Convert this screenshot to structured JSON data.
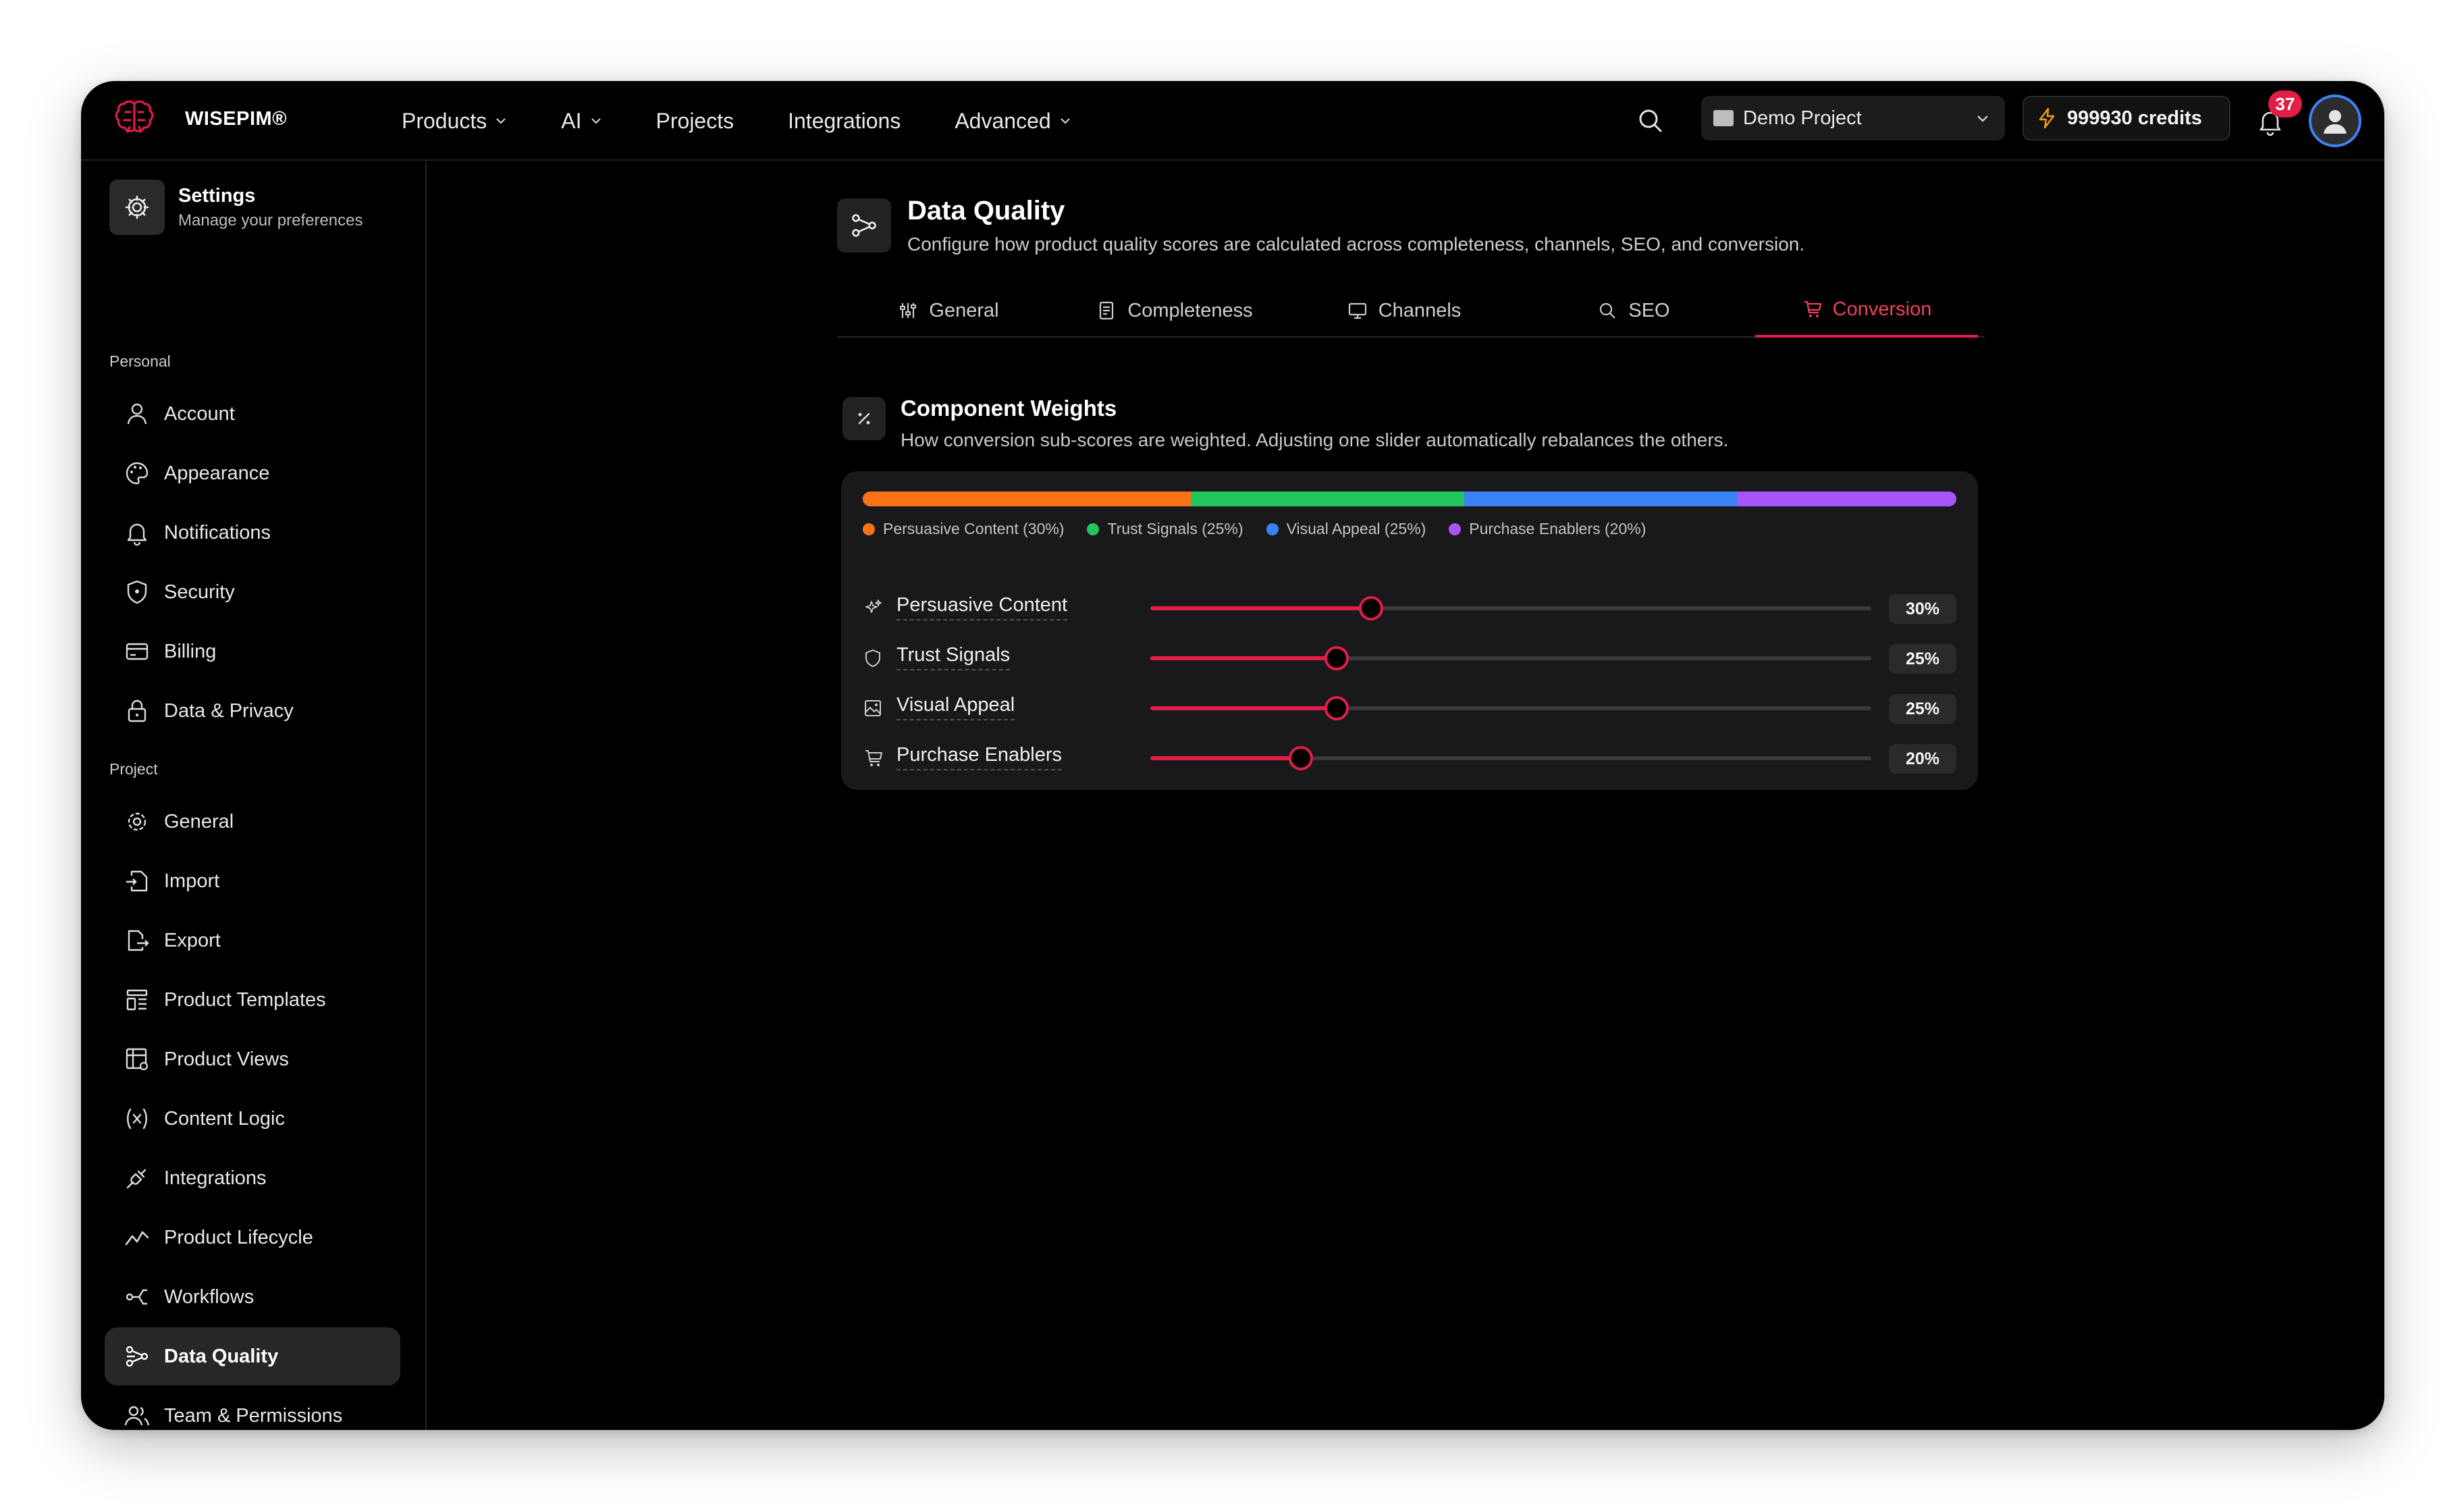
{
  "brand": {
    "name": "WISEPIM®"
  },
  "nav": [
    {
      "label": "Products",
      "dropdown": true
    },
    {
      "label": "AI",
      "dropdown": true
    },
    {
      "label": "Projects",
      "dropdown": false
    },
    {
      "label": "Integrations",
      "dropdown": false
    },
    {
      "label": "Advanced",
      "dropdown": true
    }
  ],
  "header": {
    "project": "Demo Project",
    "credits": "999930 credits",
    "notifications": "37"
  },
  "sidebar": {
    "title": "Settings",
    "subtitle": "Manage your preferences",
    "personal_label": "Personal",
    "project_label": "Project",
    "personal": [
      {
        "label": "Account",
        "icon": "user-icon"
      },
      {
        "label": "Appearance",
        "icon": "palette-icon"
      },
      {
        "label": "Notifications",
        "icon": "bell-icon"
      },
      {
        "label": "Security",
        "icon": "shield-icon"
      },
      {
        "label": "Billing",
        "icon": "credit-card-icon"
      },
      {
        "label": "Data & Privacy",
        "icon": "lock-icon"
      }
    ],
    "project": [
      {
        "label": "General",
        "icon": "gear-icon"
      },
      {
        "label": "Import",
        "icon": "file-import-icon"
      },
      {
        "label": "Export",
        "icon": "file-export-icon"
      },
      {
        "label": "Product Templates",
        "icon": "template-icon"
      },
      {
        "label": "Product Views",
        "icon": "table-settings-icon"
      },
      {
        "label": "Content Logic",
        "icon": "variable-icon"
      },
      {
        "label": "Integrations",
        "icon": "plug-icon"
      },
      {
        "label": "Product Lifecycle",
        "icon": "trend-icon"
      },
      {
        "label": "Workflows",
        "icon": "workflow-icon"
      },
      {
        "label": "Data Quality",
        "icon": "data-quality-icon",
        "active": true
      },
      {
        "label": "Team & Permissions",
        "icon": "users-icon"
      }
    ]
  },
  "page": {
    "title": "Data Quality",
    "subtitle": "Configure how product quality scores are calculated across completeness, channels, SEO, and conversion.",
    "tabs": [
      {
        "label": "General",
        "icon": "sliders-icon"
      },
      {
        "label": "Completeness",
        "icon": "checklist-icon"
      },
      {
        "label": "Channels",
        "icon": "monitor-icon"
      },
      {
        "label": "SEO",
        "icon": "search-icon"
      },
      {
        "label": "Conversion",
        "icon": "cart-icon",
        "active": true
      }
    ]
  },
  "weights": {
    "title": "Component Weights",
    "subtitle": "How conversion sub-scores are weighted. Adjusting one slider automatically rebalances the others.",
    "components": [
      {
        "label": "Persuasive Content",
        "legend": "Persuasive Content (30%)",
        "value": 30,
        "display": "30%",
        "color": "#f97316",
        "icon": "sparkles-icon"
      },
      {
        "label": "Trust Signals",
        "legend": "Trust Signals (25%)",
        "value": 25,
        "display": "25%",
        "color": "#22c55e",
        "icon": "shield-icon"
      },
      {
        "label": "Visual Appeal",
        "legend": "Visual Appeal (25%)",
        "value": 25,
        "display": "25%",
        "color": "#3b82f6",
        "icon": "image-icon"
      },
      {
        "label": "Purchase Enablers",
        "legend": "Purchase Enablers (20%)",
        "value": 20,
        "display": "20%",
        "color": "#a855f7",
        "icon": "cart-icon"
      }
    ],
    "slider_fill": [
      0.306,
      0.258,
      0.258,
      0.209
    ]
  },
  "colors": {
    "accent": "#e11d48",
    "background": "#000000",
    "panel": "#19191b"
  }
}
